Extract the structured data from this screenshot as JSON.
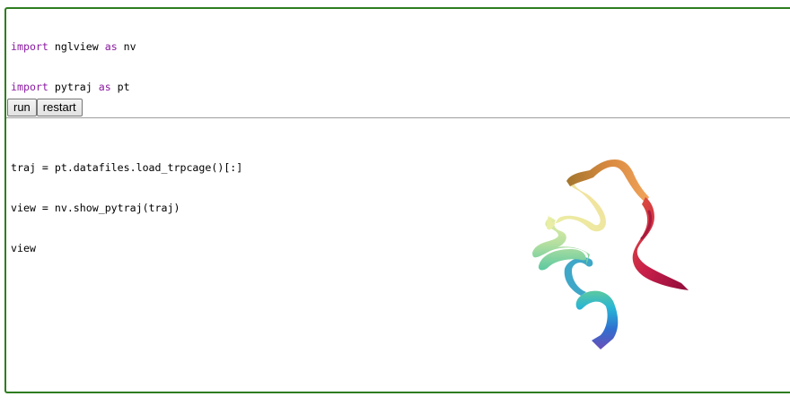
{
  "code": {
    "lines": [
      {
        "keyword": "import",
        "rest": " nglview ",
        "keyword2": "as",
        "tail": " nv"
      },
      {
        "keyword": "import",
        "rest": " pytraj ",
        "keyword2": "as",
        "tail": " pt"
      },
      {
        "plain": ""
      },
      {
        "plain": "traj = pt.datafiles.load_trpcage()[:]"
      },
      {
        "plain": "view = nv.show_pytraj(traj)"
      },
      {
        "plain": "view"
      }
    ]
  },
  "buttons": {
    "run_label": "run",
    "restart_label": "restart"
  },
  "viewer": {
    "content": "protein-ribbon-trpcage",
    "colors": [
      "#6a4fb8",
      "#2f6fd0",
      "#27b4d6",
      "#5cc9a0",
      "#b4dfa0",
      "#e9efa6",
      "#f4df9a",
      "#f2a35a",
      "#e0553a",
      "#c8204a",
      "#8e0b3a"
    ]
  },
  "colors": {
    "cell_border": "#2e7d1f",
    "keyword": "#8a1aa0"
  }
}
